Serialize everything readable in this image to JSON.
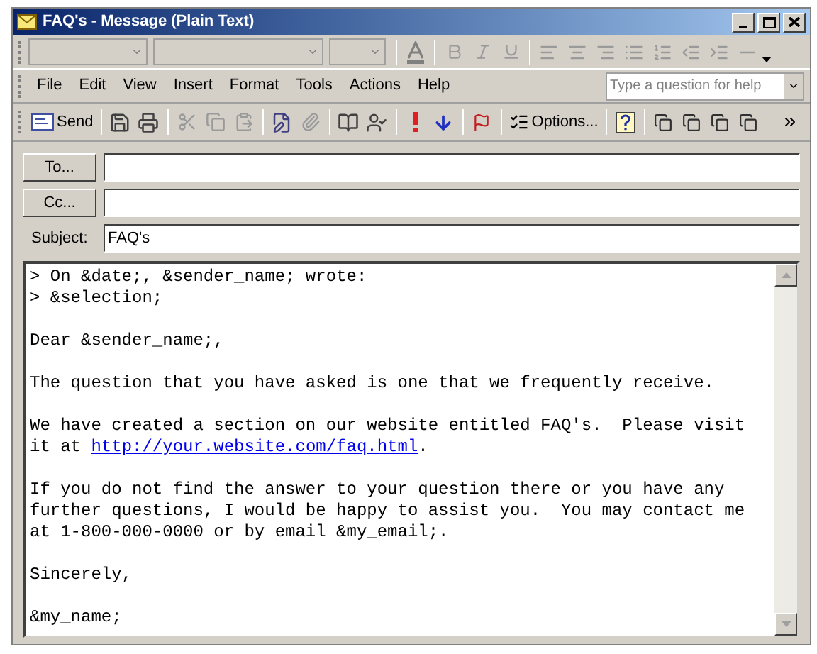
{
  "window": {
    "title": "FAQ's - Message (Plain Text)"
  },
  "menu": [
    {
      "label": "File"
    },
    {
      "label": "Edit"
    },
    {
      "label": "View"
    },
    {
      "label": "Insert"
    },
    {
      "label": "Format"
    },
    {
      "label": "Tools"
    },
    {
      "label": "Actions"
    },
    {
      "label": "Help"
    }
  ],
  "help_search": {
    "placeholder": "Type a question for help"
  },
  "toolbar": {
    "send": "Send",
    "options": "Options..."
  },
  "header_fields": [
    {
      "kind": "button",
      "label": "To..."
    },
    {
      "kind": "button",
      "label": "Cc..."
    },
    {
      "kind": "label",
      "label": "Subject:",
      "value": "FAQ's"
    }
  ],
  "body": {
    "paragraphs": [
      {
        "text": "> On &date;, &sender_name; wrote:\n> &selection;"
      },
      {
        "text": "Dear &sender_name;,"
      },
      {
        "text": "The question that you have asked is one that we frequently receive."
      },
      {
        "text": "We have created a section on our website entitled FAQ's.  Please visit it at ",
        "link": "http://your.website.com/faq.html",
        "after": "."
      },
      {
        "text": "If you do not find the answer to your question there or you have any further questions, I would be happy to assist you.  You may contact me at 1-800-000-0000 or by email &my_email;."
      },
      {
        "text": "Sincerely,"
      },
      {
        "text": "&my_name;"
      }
    ]
  }
}
